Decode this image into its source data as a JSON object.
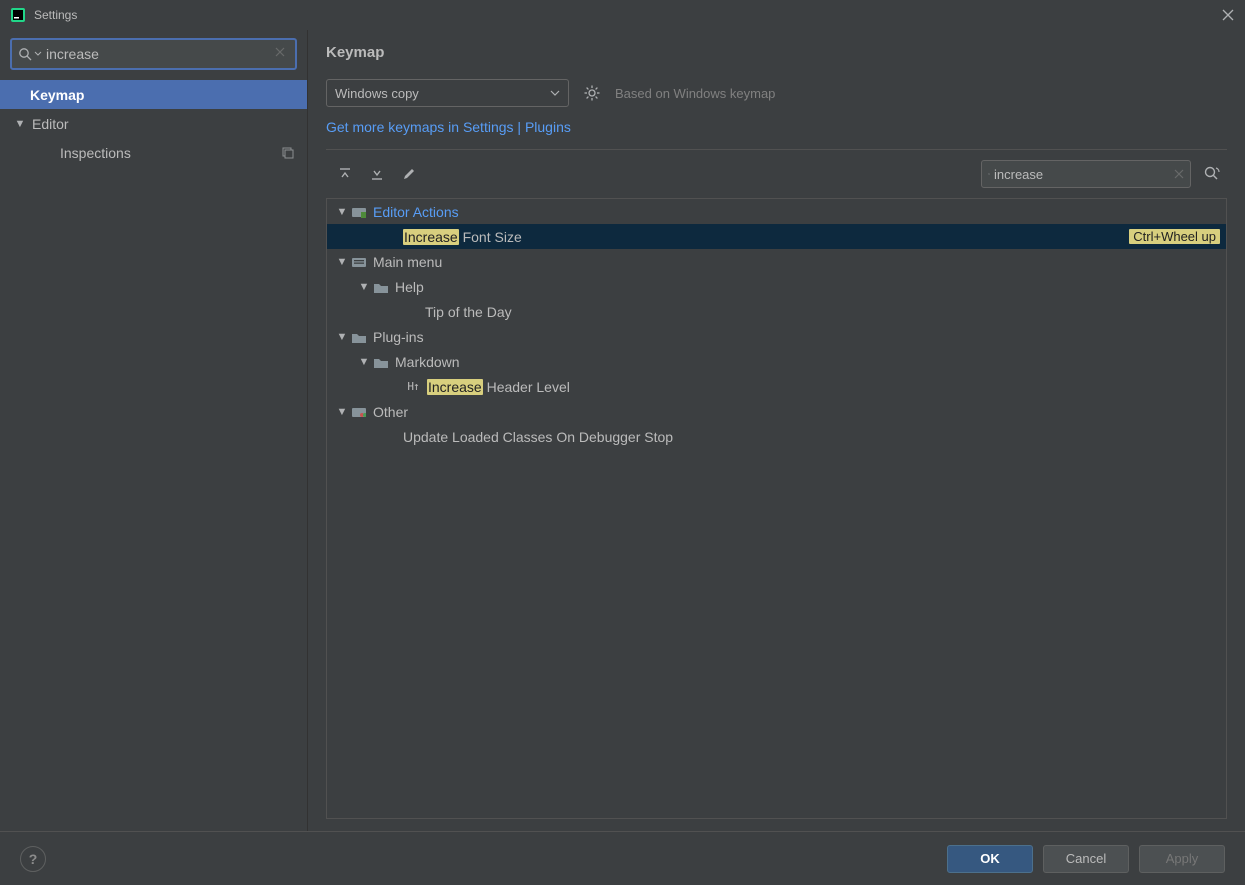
{
  "dialog": {
    "title": "Settings"
  },
  "sidebar": {
    "search": {
      "value": "increase"
    },
    "items": [
      {
        "label": "Keymap"
      },
      {
        "label": "Editor"
      },
      {
        "label": "Inspections"
      }
    ]
  },
  "content": {
    "heading": "Keymap",
    "scheme": "Windows copy",
    "basedOn": "Based on Windows keymap",
    "moreLink": "Get more keymaps in Settings | Plugins",
    "search": {
      "value": "increase"
    }
  },
  "tree": {
    "nodes": {
      "editorActions": "Editor Actions",
      "increaseFont_hl": "Increase",
      "increaseFont_rest": " Font Size",
      "increaseFont_shortcut": "Ctrl+Wheel up",
      "mainMenu": "Main menu",
      "help": "Help",
      "tipOfDay": "Tip of the Day",
      "plugins": "Plug-ins",
      "markdown": "Markdown",
      "incHeader_hl": "Increase",
      "incHeader_rest": " Header Level",
      "other": "Other",
      "updateClasses": "Update Loaded Classes On Debugger Stop"
    }
  },
  "buttons": {
    "ok": "OK",
    "cancel": "Cancel",
    "apply": "Apply"
  }
}
